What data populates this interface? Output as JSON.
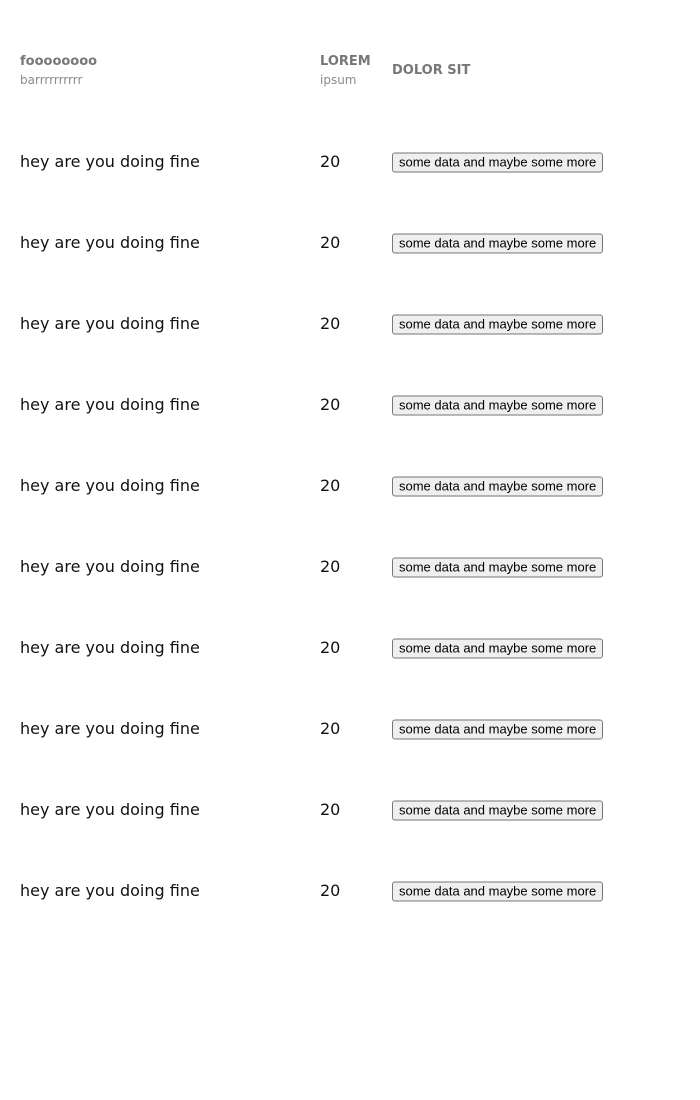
{
  "header": {
    "col1_title": "foooooooo",
    "col1_sub": "barrrrrrrrrr",
    "col2_title": "LOREM",
    "col2_sub": "ipsum",
    "col3_title": "DOLOR SIT"
  },
  "rows": [
    {
      "name": "hey are you doing fine",
      "count": "20",
      "action": "some data and maybe some more"
    },
    {
      "name": "hey are you doing fine",
      "count": "20",
      "action": "some data and maybe some more"
    },
    {
      "name": "hey are you doing fine",
      "count": "20",
      "action": "some data and maybe some more"
    },
    {
      "name": "hey are you doing fine",
      "count": "20",
      "action": "some data and maybe some more"
    },
    {
      "name": "hey are you doing fine",
      "count": "20",
      "action": "some data and maybe some more"
    },
    {
      "name": "hey are you doing fine",
      "count": "20",
      "action": "some data and maybe some more"
    },
    {
      "name": "hey are you doing fine",
      "count": "20",
      "action": "some data and maybe some more"
    },
    {
      "name": "hey are you doing fine",
      "count": "20",
      "action": "some data and maybe some more"
    },
    {
      "name": "hey are you doing fine",
      "count": "20",
      "action": "some data and maybe some more"
    },
    {
      "name": "hey are you doing fine",
      "count": "20",
      "action": "some data and maybe some more"
    }
  ]
}
